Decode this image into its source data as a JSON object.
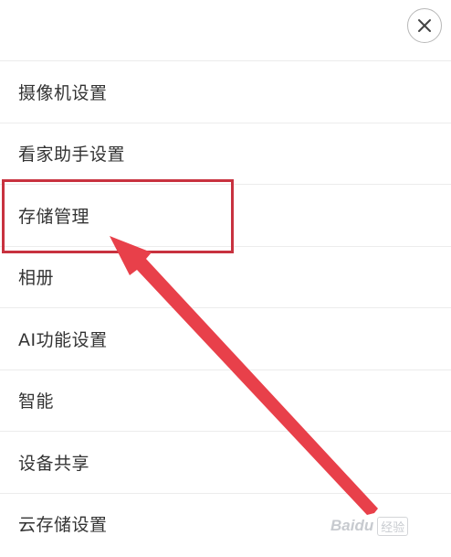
{
  "menu": {
    "items": [
      {
        "label": "摄像机设置"
      },
      {
        "label": "看家助手设置"
      },
      {
        "label": "存储管理"
      },
      {
        "label": "相册"
      },
      {
        "label": "AI功能设置"
      },
      {
        "label": "智能"
      },
      {
        "label": "设备共享"
      },
      {
        "label": "云存储设置"
      }
    ]
  },
  "close_button": {
    "icon": "close-icon"
  },
  "annotation": {
    "highlight_color": "#c8323f",
    "arrow_color": "#e8404a"
  },
  "watermark": {
    "logo": "Baidu",
    "sub": "经验"
  }
}
